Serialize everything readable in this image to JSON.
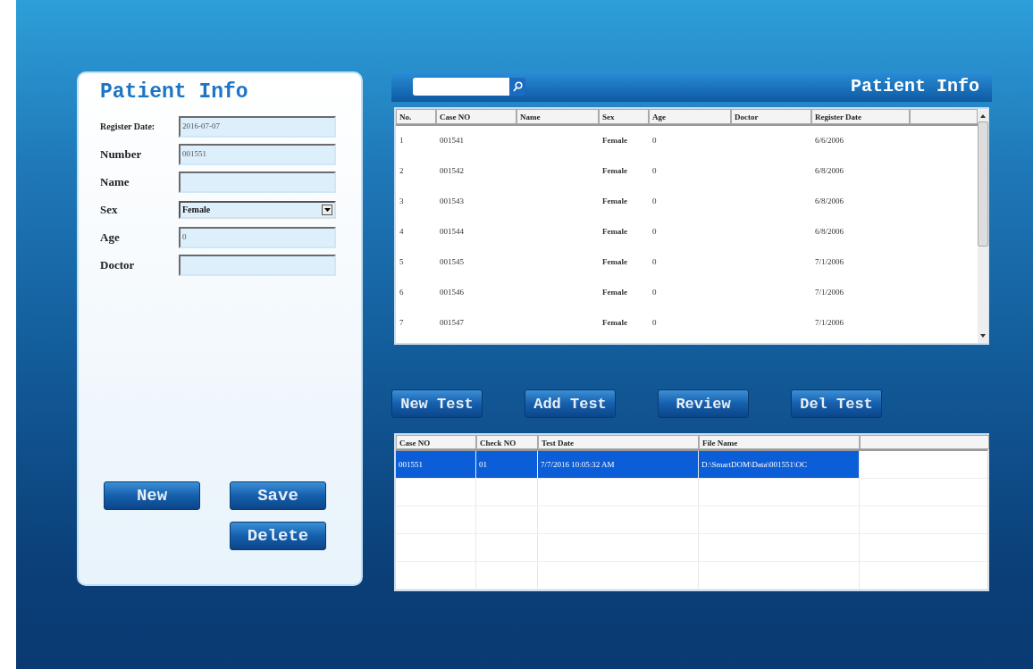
{
  "patient_form": {
    "title": "Patient Info",
    "fields": [
      {
        "label": "Register Date:",
        "value": "2016-07-07",
        "kind": "text"
      },
      {
        "label": "Number",
        "value": "001551",
        "kind": "text"
      },
      {
        "label": "Name",
        "kind": "text"
      },
      {
        "label": "Sex",
        "value": "Female",
        "kind": "select"
      },
      {
        "label": "Age",
        "value": "0",
        "kind": "text"
      },
      {
        "label": "Doctor",
        "kind": "text"
      }
    ],
    "buttons": [
      "New",
      "Save",
      "Delete"
    ]
  },
  "patient_list": {
    "title": "Patient Info",
    "columns": [
      "No.",
      "Case NO",
      "Name",
      "Sex",
      "Age",
      "Doctor",
      "Register Date"
    ],
    "rows": [
      [
        "1",
        "001541",
        "",
        "Female",
        "0",
        "",
        "6/6/2006"
      ],
      [
        "2",
        "001542",
        "",
        "Female",
        "0",
        "",
        "6/8/2006"
      ],
      [
        "3",
        "001543",
        "",
        "Female",
        "0",
        "",
        "6/8/2006"
      ],
      [
        "4",
        "001544",
        "",
        "Female",
        "0",
        "",
        "6/8/2006"
      ],
      [
        "5",
        "001545",
        "",
        "Female",
        "0",
        "",
        "7/1/2006"
      ],
      [
        "6",
        "001546",
        "",
        "Female",
        "0",
        "",
        "7/1/2006"
      ],
      [
        "7",
        "001547",
        "",
        "Female",
        "0",
        "",
        "7/1/2006"
      ]
    ]
  },
  "test_buttons": [
    "New Test",
    "Add Test",
    "Review",
    "Del Test"
  ],
  "test_list": {
    "columns": [
      "Case NO",
      "Check NO",
      "Test Date",
      "File Name"
    ],
    "rows": [
      {
        "cells": [
          "001551",
          "01",
          "7/7/2016 10:05:32 AM",
          "D:\\SmartDOM\\Data\\001551\\OC"
        ],
        "selected": true
      }
    ]
  }
}
